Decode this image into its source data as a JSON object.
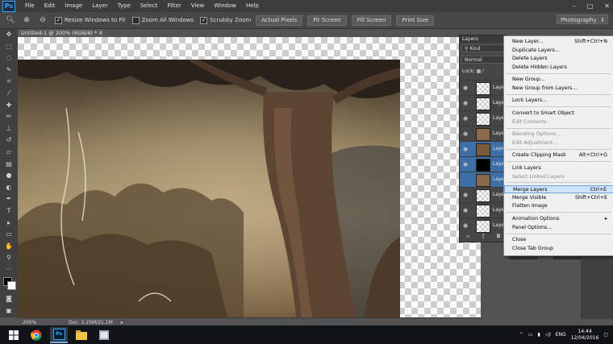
{
  "app": {
    "logo": "Ps"
  },
  "menu": [
    "File",
    "Edit",
    "Image",
    "Layer",
    "Type",
    "Select",
    "Filter",
    "View",
    "Window",
    "Help"
  ],
  "window_controls": [
    "–",
    "□",
    "✕"
  ],
  "options_bar": {
    "resize_windows": "Resize Windows to Fit",
    "zoom_all": "Zoom All Windows",
    "scrubby": "Scrubby Zoom",
    "actual_pixels": "Actual Pixels",
    "fit_screen": "Fit Screen",
    "fill_screen": "Fill Screen",
    "print_size": "Print Size",
    "workspace": "Photography"
  },
  "document": {
    "tab_title": "Untitled-1 @ 200% (RGB/8) *"
  },
  "status": {
    "zoom": "200%",
    "doc": "Doc: 2.25M/21.1M"
  },
  "layers_panel": {
    "tab": "Layers",
    "filter": "Kind",
    "blend_mode": "Normal",
    "lock_label": "Lock:",
    "layer_label": "Laye"
  },
  "context_menu": {
    "items": [
      {
        "label": "New Layer...",
        "shortcut": "Shift+Ctrl+N",
        "disabled": false
      },
      {
        "label": "Duplicate Layers...",
        "shortcut": "",
        "disabled": false
      },
      {
        "label": "Delete Layers",
        "shortcut": "",
        "disabled": false
      },
      {
        "label": "Delete Hidden Layers",
        "shortcut": "",
        "disabled": false
      },
      {
        "label": "New Group...",
        "shortcut": "",
        "disabled": false
      },
      {
        "label": "New Group from Layers...",
        "shortcut": "",
        "disabled": false
      },
      {
        "label": "Lock Layers...",
        "shortcut": "",
        "disabled": false
      },
      {
        "label": "Convert to Smart Object",
        "shortcut": "",
        "disabled": false
      },
      {
        "label": "Edit Contents",
        "shortcut": "",
        "disabled": true
      },
      {
        "label": "Blending Options...",
        "shortcut": "",
        "disabled": true
      },
      {
        "label": "Edit Adjustment...",
        "shortcut": "",
        "disabled": true
      },
      {
        "label": "Create Clipping Mask",
        "shortcut": "Alt+Ctrl+G",
        "disabled": false
      },
      {
        "label": "Link Layers",
        "shortcut": "",
        "disabled": false
      },
      {
        "label": "Select Linked Layers",
        "shortcut": "",
        "disabled": true
      },
      {
        "label": "Merge Layers",
        "shortcut": "Ctrl+E",
        "disabled": false,
        "highlighted": true
      },
      {
        "label": "Merge Visible",
        "shortcut": "Shift+Ctrl+E",
        "disabled": false
      },
      {
        "label": "Flatten Image",
        "shortcut": "",
        "disabled": false
      },
      {
        "label": "Animation Options",
        "shortcut": "▸",
        "disabled": false
      },
      {
        "label": "Panel Options...",
        "shortcut": "",
        "disabled": false
      },
      {
        "label": "Close",
        "shortcut": "",
        "disabled": false
      },
      {
        "label": "Close Tab Group",
        "shortcut": "",
        "disabled": false
      }
    ]
  },
  "taskbar": {
    "lang": "ENG",
    "time": "14:44",
    "date": "12/04/2016"
  },
  "colors": {
    "accent": "#31a8ff",
    "menu_highlight": "#cfe3fb",
    "layer_selected": "#3d6ea6"
  }
}
